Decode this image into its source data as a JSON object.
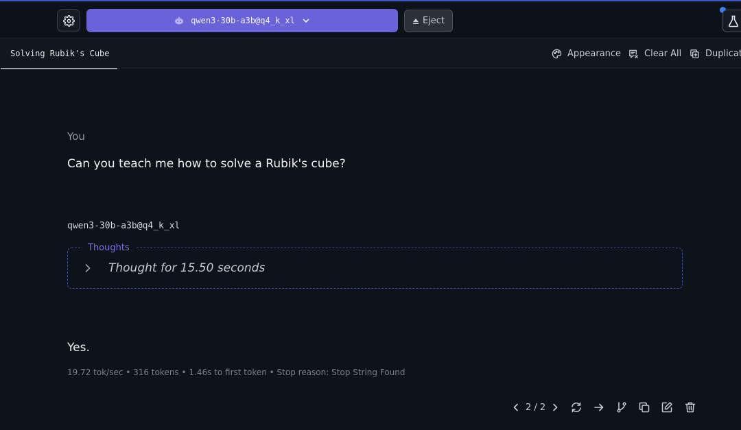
{
  "header": {
    "model_label": "qwen3-30b-a3b@q4_k_xl",
    "eject_label": "Eject"
  },
  "tabs": {
    "active_tab": "Solving Rubik's Cube",
    "actions": {
      "appearance": "Appearance",
      "clear_all": "Clear All",
      "duplicate": "Duplicate"
    }
  },
  "conversation": {
    "user_label": "You",
    "user_message": "Can you teach me how to solve a Rubik's cube?",
    "assistant_model": "qwen3-30b-a3b@q4_k_xl",
    "thoughts_label": "Thoughts",
    "thought_summary": "Thought for 15.50 seconds",
    "reply": "Yes.",
    "stats": "19.72 tok/sec • 316 tokens • 1.46s to first token • Stop reason: Stop String Found"
  },
  "pagination": {
    "label": "2 / 2"
  },
  "icons": {
    "settings": "gear-icon",
    "model": "robot-icon",
    "dropdown": "chevron-down-icon",
    "eject": "eject-icon",
    "flask": "flask-icon",
    "appearance": "palette-icon",
    "clear_all": "clear-chat-icon",
    "duplicate": "duplicate-icon",
    "regenerate": "regenerate-icon",
    "continue": "arrow-right-icon",
    "branch": "branch-icon",
    "copy": "copy-icon",
    "edit": "edit-icon",
    "delete": "trash-icon"
  },
  "colors": {
    "background": "#0e1219",
    "accent": "#6a62d8",
    "thoughts_border": "#3d4fa8",
    "notification": "#3b82f6"
  }
}
